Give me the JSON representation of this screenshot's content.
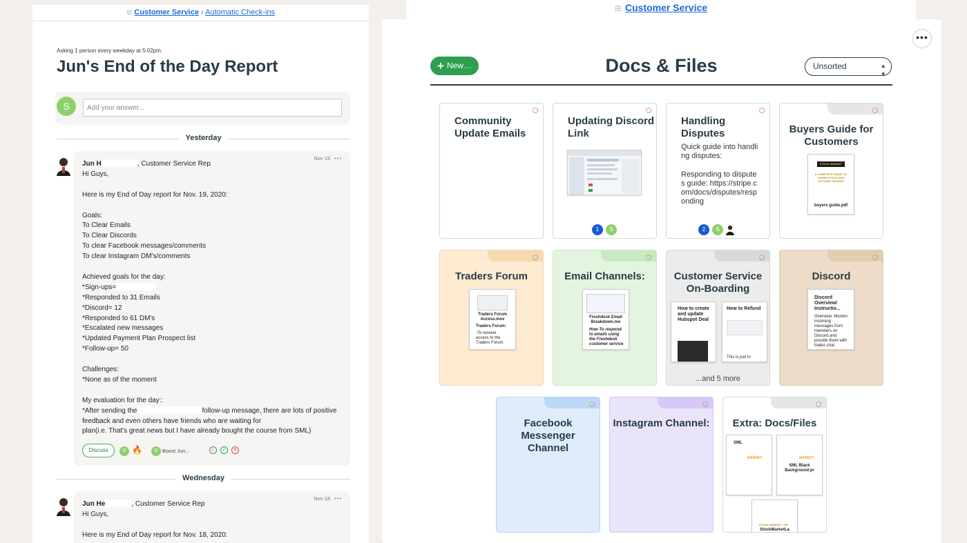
{
  "left": {
    "breadcrumb": {
      "root": "Customer Service",
      "sep": "›",
      "current": "Automatic Check-ins"
    },
    "asking": "Asking 1 person every weekday at 5:02pm.",
    "title": "Jun's End of the Day Report",
    "answer_placeholder": "Add your answer...",
    "answer_avatar": "S",
    "day1": "Yesterday",
    "day2": "Wednesday",
    "entry1": {
      "date": "Nov 19",
      "author": "Jun H",
      "role": ", Customer Service Rep",
      "lines": [
        "Hi Guys,",
        "",
        "Here is my End of Day report for Nov. 19, 2020:",
        "",
        "Goals:",
        "To Clear Emails",
        "To Clear Discords",
        "To clear Facebook messages/comments",
        "To clear Instagram DM's/comments",
        "",
        "Achieved goals for the day:",
        "*Sign-ups=",
        "*Responded to 31 Emails",
        "*Discord= 12",
        "*Responded to 61 DM's",
        "*Escalated new messages",
        "*Updated Payment Plan Prospect list",
        "*Follow-up= 50",
        "",
        "Challenges:",
        "*None as of the moment",
        "",
        "My evaluation for the day::"
      ],
      "eval_a": "*After sending the",
      "eval_b": "follow-up message, there are lots of positive",
      "eval_c": "feedback and even others have friends who are waiting for",
      "eval_d": "plan(i.e. That's great news but I have already bought the course from SML)",
      "discuss": "Discuss",
      "boost": "Boost Jun...",
      "reaction_avatar": "S",
      "boost_avatar": "S"
    },
    "entry2": {
      "date": "Nov 18",
      "author": "Jun He",
      "role": ", Customer Service Rep",
      "line1": "Hi Guys,",
      "line2": "Here is my End of Day report for Nov. 18, 2020:"
    }
  },
  "right": {
    "breadcrumb": "Customer Service",
    "new_button": "New…",
    "title": "Docs & Files",
    "sort": "Unsorted",
    "cards": {
      "c1": {
        "title": "Community Update Emails"
      },
      "c2": {
        "title": "Updating Discord Link",
        "p1": "1",
        "p2": "S"
      },
      "c3": {
        "title": "Handling Disputes",
        "body1": "Quick guide into handling disputes:",
        "body2": "Responding to disputes guide: https://stripe.com/docs/disputes/responding",
        "p1": "2",
        "p2": "S"
      },
      "c4": {
        "title": "Buyers Guide for Customers",
        "thumb": "buyers guide.pdf",
        "thumb_head": "STOCK MARKET",
        "thumb_sub": "A COMPLETE GUIDE TO LEARN STOCK AND OPTIONS TRADING"
      },
      "c5": {
        "title": "Traders Forum",
        "thumb_title": "Traders Forum Access.mov",
        "thumb_h": "Traders Forum:",
        "thumb_body": "-To receive access to the Traders Forum"
      },
      "c6": {
        "title": "Email Channels:",
        "thumb_title": "Freshdesk Email Breakdown.mo",
        "thumb_body": "How To respond to emails using the Freshdesk customer service"
      },
      "c7": {
        "title": "Customer Service On-Boarding",
        "t1": "How to create and update Hubspot Deal",
        "t2": "How to Refund",
        "t2_body": "This is just in",
        "more": "...and 5 more"
      },
      "c8": {
        "title": "Discord",
        "thumb_title": "Discord Overview/ Instructio...",
        "thumb_body": "Overview: Monitor incoming messages from members on Discord and provide them with trader-chat"
      },
      "c9": {
        "title": "Facebook Messenger Channel"
      },
      "c10": {
        "title": "Instagram Channel:"
      },
      "c11": {
        "title": "Extra: Docs/Files",
        "t1": "SML",
        "t1_logo": "MARKET",
        "t2_logo": "MARKET",
        "t2": "SML Black Background.pr",
        "t3_logo": "STOCK MARKET LAB",
        "t3": "StockMarketLa"
      }
    }
  }
}
